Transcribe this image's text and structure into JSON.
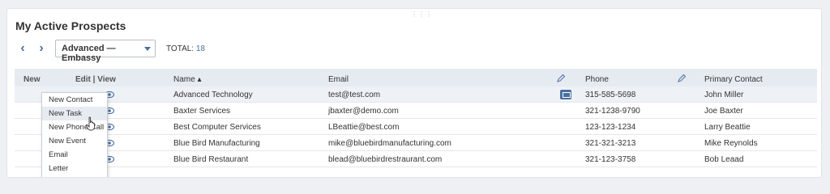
{
  "portlet": {
    "title": "My Active Prospects",
    "drag_handle": "⋮⋮⋮",
    "nav": {
      "prev": "‹",
      "next": "›"
    },
    "view_selector": "Advanced — Embassy",
    "total_label": "TOTAL:",
    "total_count": "18"
  },
  "columns": {
    "new": "New",
    "edit_view": "Edit | View",
    "name": "Name ▴",
    "email": "Email",
    "phone": "Phone",
    "primary_contact": "Primary Contact"
  },
  "rows": [
    {
      "name": "Advanced Technology",
      "email": "test@test.com",
      "phone": "315-585-5698",
      "contact": "John Miller"
    },
    {
      "name": "Baxter Services",
      "email": "jbaxter@demo.com",
      "phone": "321-1238-9790",
      "contact": "Joe Baxter"
    },
    {
      "name": "Best Computer Services",
      "email": "LBeattie@best.com",
      "phone": "123-123-1234",
      "contact": "Larry Beattie"
    },
    {
      "name": "Blue Bird Manufacturing",
      "email": "mike@bluebirdmanufacturing.com",
      "phone": "321-321-3213",
      "contact": "Mike Reynolds"
    },
    {
      "name": "Blue Bird Restaurant",
      "email": "blead@bluebirdrestraurant.com",
      "phone": "321-123-3758",
      "contact": "Bob Leaad"
    }
  ],
  "new_menu": {
    "items": [
      "New Contact",
      "New Task",
      "New Phone Call",
      "New Event",
      "Email",
      "Letter"
    ],
    "hovered_index": 1
  },
  "icons": {
    "add": "add-record-icon",
    "view": "eye-icon",
    "edit_column": "pencil-icon",
    "email_action": "envelope-icon",
    "cursor": "hand-pointer-icon"
  },
  "colors": {
    "accent": "#4a6fa0",
    "header_bg": "#e6ebf1",
    "add_icon": "#6aa84f"
  }
}
